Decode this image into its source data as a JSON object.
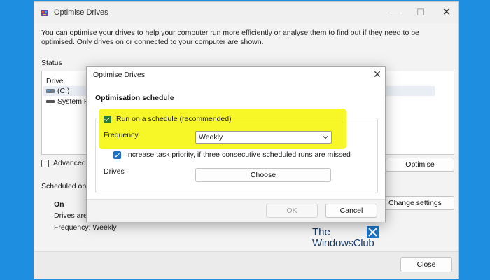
{
  "main_window": {
    "title": "Optimise Drives",
    "intro": "You can optimise your drives to help your computer run more efficiently or analyse them to find out if they need to be optimised. Only drives on or connected to your computer are shown.",
    "status_label": "Status",
    "drive_column": "Drive",
    "drives": [
      {
        "label": "(C:)"
      },
      {
        "label": "System R"
      }
    ],
    "advanced_label": "Advanced",
    "optimise_button": "Optimise",
    "scheduled_label": "Scheduled opti",
    "schedule_state": "On",
    "drives_line": "Drives are",
    "frequency_line": "Frequency: Weekly",
    "change_settings_button": "Change settings",
    "close_button": "Close"
  },
  "dialog": {
    "title": "Optimise Drives",
    "close_glyph": "✕",
    "section_title": "Optimisation schedule",
    "run_on_schedule_label": "Run on a schedule (recommended)",
    "run_on_schedule_checked": true,
    "frequency_label": "Frequency",
    "frequency_value": "Weekly",
    "priority_label": "Increase task priority, if three consecutive scheduled runs are missed",
    "priority_checked": true,
    "drives_label": "Drives",
    "choose_button": "Choose",
    "ok_button": "OK",
    "cancel_button": "Cancel"
  },
  "watermark": {
    "line1": "The",
    "line2": "WindowsClub"
  },
  "colors": {
    "background": "#1e8fe0",
    "highlight": "#f6f500",
    "checkbox_blue": "#1f6fbf",
    "checkbox_green": "#2e7d32"
  },
  "icons": [
    "app-defrag-icon",
    "minimize-icon",
    "maximize-icon",
    "close-icon",
    "drive-icon",
    "chevron-down-icon",
    "windowsclub-logo-icon"
  ]
}
